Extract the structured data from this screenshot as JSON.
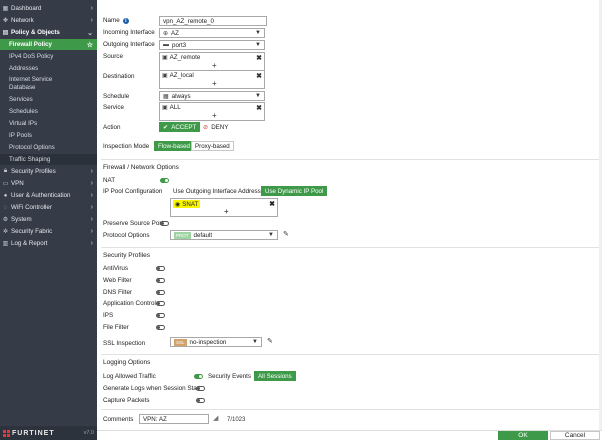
{
  "sidebar": {
    "items": [
      {
        "label": "Dashboard",
        "icon": "dashboard-icon",
        "chevron": "›"
      },
      {
        "label": "Network",
        "icon": "network-icon",
        "chevron": "›"
      },
      {
        "label": "Policy & Objects",
        "icon": "policy-icon",
        "chevron": "⌄"
      },
      {
        "label": "Firewall Policy",
        "active": true
      },
      {
        "label": "IPv4 DoS Policy"
      },
      {
        "label": "Addresses"
      },
      {
        "label": "Internet Service Database"
      },
      {
        "label": "Services"
      },
      {
        "label": "Schedules"
      },
      {
        "label": "Virtual IPs"
      },
      {
        "label": "IP Pools"
      },
      {
        "label": "Protocol Options"
      },
      {
        "label": "Traffic Shaping"
      },
      {
        "label": "Security Profiles",
        "icon": "lock-icon",
        "chevron": "›"
      },
      {
        "label": "VPN",
        "icon": "vpn-icon",
        "chevron": "›"
      },
      {
        "label": "User & Authentication",
        "icon": "user-icon",
        "chevron": "›"
      },
      {
        "label": "WiFi Controller",
        "icon": "wifi-icon",
        "chevron": "›"
      },
      {
        "label": "System",
        "icon": "gear-icon",
        "chevron": "›"
      },
      {
        "label": "Security Fabric",
        "icon": "fabric-icon",
        "chevron": "›"
      },
      {
        "label": "Log & Report",
        "icon": "chart-icon",
        "chevron": "›"
      }
    ],
    "brand": "FURTINET",
    "version": "v7.0"
  },
  "form": {
    "name_label": "Name",
    "name_value": "vpn_AZ_remote_0",
    "incoming_label": "Incoming Interface",
    "incoming_value": "AZ",
    "outgoing_label": "Outgoing Interface",
    "outgoing_value": "port3",
    "source_label": "Source",
    "source_value": "AZ_remote",
    "destination_label": "Destination",
    "destination_value": "AZ_local",
    "schedule_label": "Schedule",
    "schedule_value": "always",
    "service_label": "Service",
    "service_value": "ALL",
    "action_label": "Action",
    "action_accept": "ACCEPT",
    "action_deny": "DENY",
    "inspection_label": "Inspection Mode",
    "inspection_flow": "Flow-based",
    "inspection_proxy": "Proxy-based"
  },
  "firewall": {
    "title": "Firewall / Network Options",
    "nat_label": "NAT",
    "ippool_label": "IP Pool Configuration",
    "use_outgoing": "Use Outgoing Interface Address",
    "use_dynamic": "Use Dynamic IP Pool",
    "snat_value": "SNAT",
    "preserve_label": "Preserve Source Port",
    "protocol_label": "Protocol Options",
    "protocol_tag": "PROT",
    "protocol_value": "default"
  },
  "security": {
    "title": "Security Profiles",
    "antivirus": "AntiVirus",
    "webfilter": "Web Filter",
    "dnsfilter": "DNS Filter",
    "appcontrol": "Application Control",
    "ips": "IPS",
    "filefilter": "File Filter",
    "ssl_label": "SSL Inspection",
    "ssl_tag": "SSL",
    "ssl_value": "no-inspection"
  },
  "logging": {
    "title": "Logging Options",
    "log_allowed": "Log Allowed Traffic",
    "security_events": "Security Events",
    "all_sessions": "All Sessions",
    "gen_logs": "Generate Logs when Session Starts",
    "capture": "Capture Packets"
  },
  "comments": {
    "label": "Comments",
    "value": "VPN: AZ",
    "counter": "7/1023"
  },
  "footer": {
    "ok": "OK",
    "cancel": "Cancel"
  }
}
